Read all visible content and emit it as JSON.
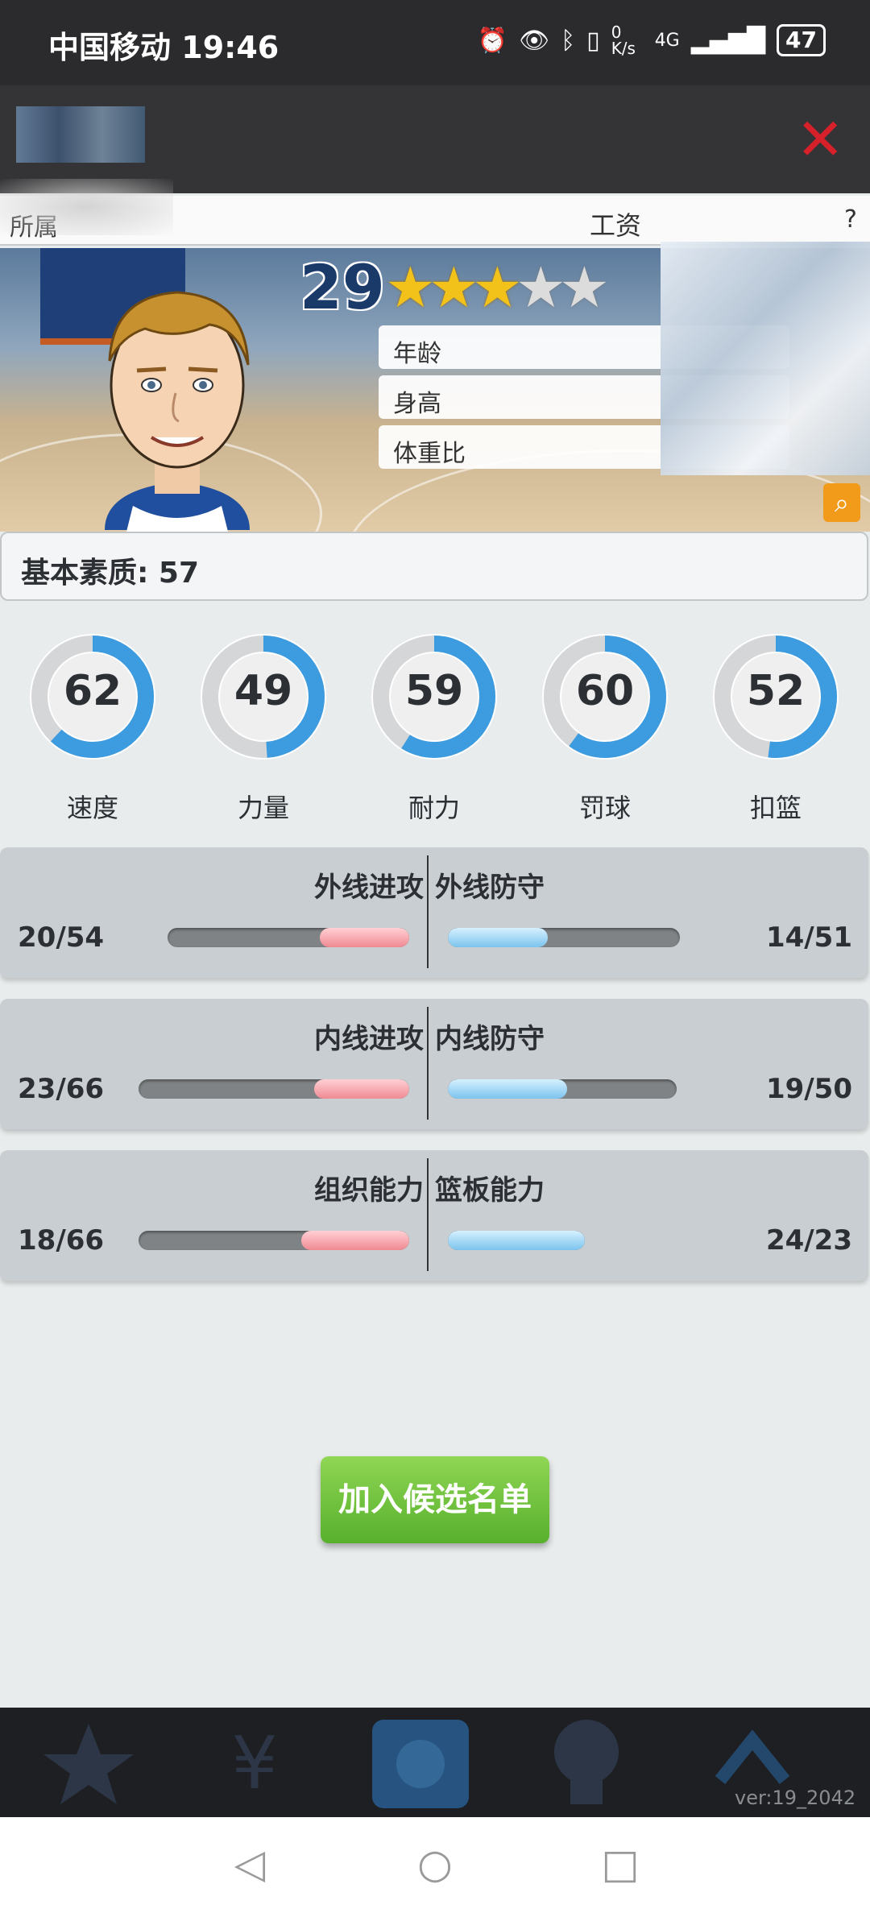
{
  "status_bar": {
    "carrier": "中国移动",
    "time": "19:46",
    "net_speed": "0 K/s",
    "signal": "4G",
    "battery": "47"
  },
  "info_bar": {
    "left_label": "所属",
    "middle_label": "工资",
    "right_label": "?"
  },
  "player": {
    "rating": "29",
    "stars_filled": 3,
    "stars_total": 5,
    "attributes": [
      {
        "label": "年龄"
      },
      {
        "label": "身高"
      },
      {
        "label": "体重比"
      }
    ]
  },
  "basic": {
    "label": "基本素质: 57"
  },
  "abilities": [
    {
      "label": "速度",
      "value": "62",
      "fraction": 0.62
    },
    {
      "label": "力量",
      "value": "49",
      "fraction": 0.49
    },
    {
      "label": "耐力",
      "value": "59",
      "fraction": 0.59
    },
    {
      "label": "罚球",
      "value": "60",
      "fraction": 0.6
    },
    {
      "label": "扣篮",
      "value": "52",
      "fraction": 0.52
    }
  ],
  "comparisons": [
    {
      "left_title": "外线进攻",
      "right_title": "外线防守",
      "left_value": "20/54",
      "right_value": "14/51",
      "left_fraction": 0.37,
      "right_fraction": 0.43
    },
    {
      "left_title": "内线进攻",
      "right_title": "内线防守",
      "left_value": "23/66",
      "right_value": "19/50",
      "left_fraction": 0.35,
      "right_fraction": 0.52
    },
    {
      "left_title": "组织能力",
      "right_title": "篮板能力",
      "left_value": "18/66",
      "right_value": "24/23",
      "left_fraction": 0.4,
      "right_fraction": 1.0
    }
  ],
  "add_button": {
    "label": "加入候选名单"
  },
  "version": "ver:19_2042",
  "colors": {
    "ring_blue": "#3d9be0",
    "ring_grey": "#d4d6d8",
    "close_red": "#d6202a",
    "button_green": "#6cc23a",
    "search_orange": "#f29a1a"
  }
}
